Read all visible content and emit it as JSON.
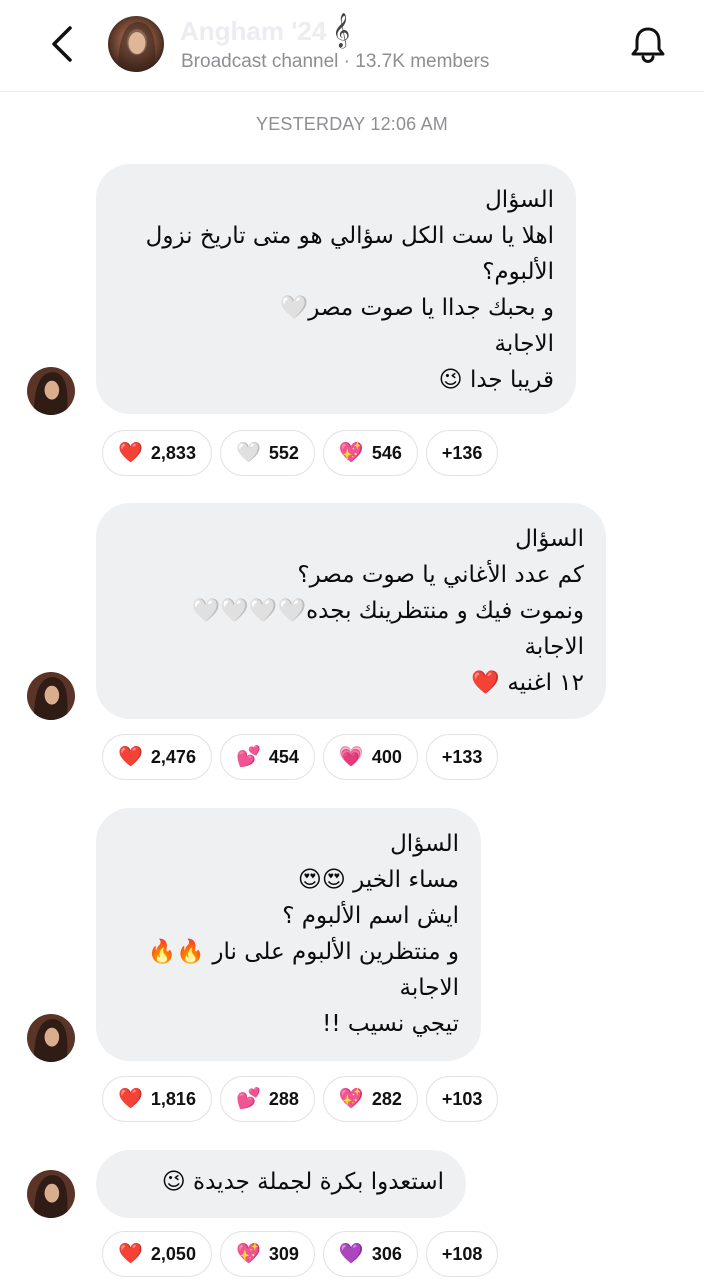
{
  "header": {
    "channel_name": "Angham '24",
    "title_icon": "𝄞",
    "subtitle": "Broadcast channel · 13.7K members"
  },
  "timestamp": "YESTERDAY 12:06 AM",
  "messages": [
    {
      "lines": [
        "السؤال",
        "اهلا يا ست الكل سؤالي هو متى تاريخ نزول",
        "الألبوم؟",
        "و بحبك جداا يا صوت مصر🤍",
        "الاجابة",
        "قريبا جدا 😉"
      ],
      "reactions": [
        {
          "emoji": "❤️",
          "count": "2,833"
        },
        {
          "emoji": "🤍",
          "count": "552"
        },
        {
          "emoji": "💖",
          "count": "546"
        },
        {
          "emoji": "",
          "count": "+136"
        }
      ]
    },
    {
      "lines": [
        "السؤال",
        "كم عدد الأغاني يا صوت مصر؟",
        "ونموت فيك و منتظرينك بجده🤍🤍🤍🤍",
        "الاجابة",
        "١٢ اغنيه ❤️"
      ],
      "reactions": [
        {
          "emoji": "❤️",
          "count": "2,476"
        },
        {
          "emoji": "💕",
          "count": "454"
        },
        {
          "emoji": "💗",
          "count": "400"
        },
        {
          "emoji": "",
          "count": "+133"
        }
      ]
    },
    {
      "lines": [
        "السؤال",
        "مساء الخير 😍😍",
        "ايش اسم الألبوم ؟",
        "و منتظرين الألبوم على نار 🔥🔥",
        "الاجابة",
        "تيجي نسيب !!"
      ],
      "reactions": [
        {
          "emoji": "❤️",
          "count": "1,816"
        },
        {
          "emoji": "💕",
          "count": "288"
        },
        {
          "emoji": "💖",
          "count": "282"
        },
        {
          "emoji": "",
          "count": "+103"
        }
      ]
    },
    {
      "lines": [
        "استعدوا بكرة لجملة جديدة 😉"
      ],
      "reactions": [
        {
          "emoji": "❤️",
          "count": "2,050"
        },
        {
          "emoji": "💖",
          "count": "309"
        },
        {
          "emoji": "💜",
          "count": "306"
        },
        {
          "emoji": "",
          "count": "+108"
        }
      ]
    }
  ]
}
